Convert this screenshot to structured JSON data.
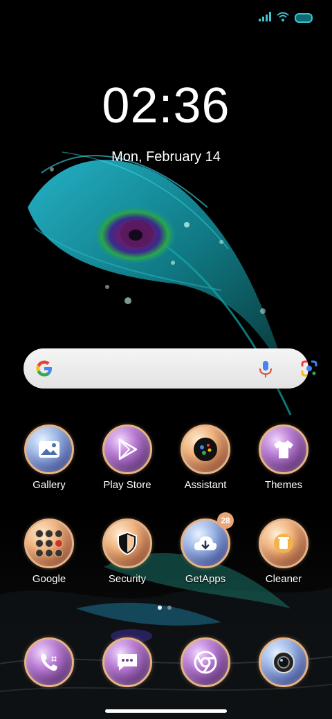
{
  "clock": {
    "time": "02:36",
    "date": "Mon, February 14"
  },
  "status_bar": {
    "icons": [
      "signal-icon",
      "wifi-icon",
      "battery-icon"
    ]
  },
  "search_bar": {
    "icons": [
      "google-g-icon",
      "microphone-icon",
      "google-lens-icon"
    ]
  },
  "apps_row1": [
    {
      "label": "Gallery",
      "icon": "gallery-icon"
    },
    {
      "label": "Play Store",
      "icon": "play-store-icon"
    },
    {
      "label": "Assistant",
      "icon": "assistant-icon"
    },
    {
      "label": "Themes",
      "icon": "themes-shirt-icon"
    }
  ],
  "apps_row2": [
    {
      "label": "Google",
      "icon": "google-folder-icon"
    },
    {
      "label": "Security",
      "icon": "security-shield-icon"
    },
    {
      "label": "GetApps",
      "icon": "getapps-download-icon",
      "badge": "28"
    },
    {
      "label": "Cleaner",
      "icon": "cleaner-trash-icon"
    }
  ],
  "dock": [
    {
      "icon": "phone-icon"
    },
    {
      "icon": "messages-icon"
    },
    {
      "icon": "chrome-icon"
    },
    {
      "icon": "camera-icon"
    }
  ],
  "page_indicator": {
    "count": 2,
    "active": 1
  },
  "colors": {
    "accent": "#e7b383",
    "battery": "#3ec3d2",
    "search_bar": "#f0f0f0"
  }
}
